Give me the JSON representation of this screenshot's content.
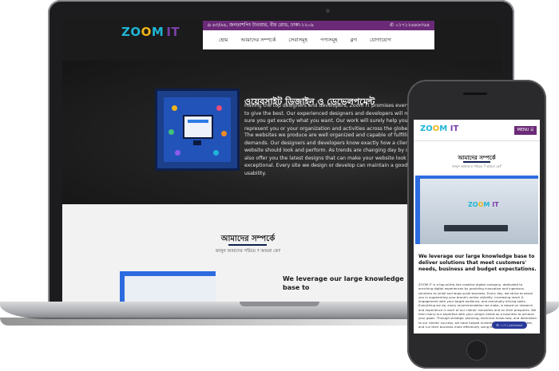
{
  "site": {
    "logo_main": "ZO",
    "logo_o": "O",
    "logo_m": "M",
    "logo_it": "IT",
    "topbar": {
      "address": "৬৩/৬৪, জনতাশপিং টাওয়ার, বীর রোড, ঢাকা-১২০৯",
      "phone": "০১৭১২৬৪৬৩৬৪"
    },
    "nav": [
      "হোম",
      "আমাদের সম্পর্কে",
      "সেবাসমূহ",
      "পণ্যসমূহ",
      "ব্লগ",
      "যোগাযোগ"
    ]
  },
  "hero": {
    "title": "ওয়েবসাইট ডিজাইন ও ডেভেলপমেন্ট",
    "paragraph1": "Having the top designers and developers, Zoom IT promises every client to give the best. Our experienced designers and developers will make sure you get exactly what you want. Our work will surely help you to represent you or your organization and activities across the globe.",
    "paragraph2": "The websites we produce are well organized and capable of fulfilling your demands. Our designers and developers know exactly how a client's website should look and perform. As trends are changing day by day, we also offer you the latest designs that can make your website look exceptional. Every site we design or develop can maintain a good rate of usability."
  },
  "about": {
    "title": "আমাদের সম্পর্কে",
    "subtitle": "জানুন আমাদের পরিচয় ? আমরা কে?",
    "heading": "We leverage our large knowledge base to"
  },
  "phone": {
    "menu_label": "MENU ☰",
    "title": "আমাদের সম্পর্কে",
    "subtitle": "জানুন আমাদের পরিচয় ? আমরা কে?",
    "heading": "We leverage our large knowledge base to deliver solutions that meet customers' needs, business and budget expectations.",
    "body": "ZOOM IT is a top-of-the-line creative digital company, dedicated to enriching digital experiences by providing innovative and ingenious solutions to small and large-scale business. Every day, we strive to assist you in augmenting your brand's online visibility, increasing reach & engagement with your target audience, and eventually driving sales. Everything we do, every recommendation we make, is based on research and experience in each of our clients' industries and on their prospects. We then marry our expertise with your unique needs as a business to achieve your goals. Through strategic planning, technical know-how, and dedication to our clients' success, we have helped hundreds of clients grow, market, and run their business more effectively using the web.",
    "call_label": "০১৭১২৬৪৬৩৬৪"
  },
  "colors": {
    "brand_cyan": "#1fb5d5",
    "brand_yellow": "#f0b516",
    "brand_purple": "#6b2a78",
    "navy": "#0d1f4d",
    "accent_blue": "#2d6be0"
  },
  "icons": [
    "location-icon",
    "phone-icon",
    "menu-icon"
  ]
}
